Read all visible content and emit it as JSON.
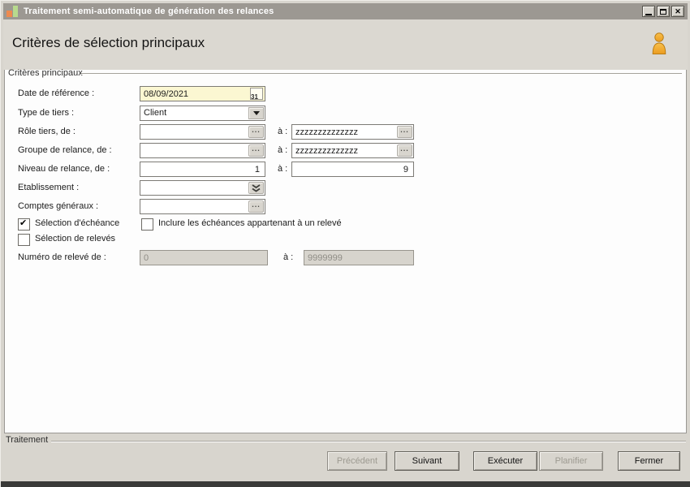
{
  "window": {
    "title": "Traitement semi-automatique de génération des relances"
  },
  "header": {
    "title": "Critères de sélection principaux"
  },
  "main": {
    "group_label": "Critères principaux",
    "fields": {
      "date_reference": {
        "label": "Date de référence :",
        "value": "08/09/2021",
        "calendar_icon_text": "31"
      },
      "type_tiers": {
        "label": "Type de tiers :",
        "value": "Client"
      },
      "role_tiers": {
        "label": "Rôle tiers, de :",
        "from": "",
        "to_label": "à :",
        "to": "zzzzzzzzzzzzzz"
      },
      "groupe_relance": {
        "label": "Groupe de relance, de :",
        "from": "",
        "to_label": "à :",
        "to": "zzzzzzzzzzzzzz"
      },
      "niveau_relance": {
        "label": "Niveau de relance, de :",
        "from": "1",
        "to_label": "à :",
        "to": "9"
      },
      "etablissement": {
        "label": "Etablissement :",
        "value": ""
      },
      "comptes_generaux": {
        "label": "Comptes généraux :",
        "value": ""
      },
      "numero_releve": {
        "label": "Numéro de relevé de :",
        "from": "0",
        "to_label": "à :",
        "to": "9999999",
        "disabled": true
      }
    },
    "checkboxes": {
      "selection_echeance": {
        "label": "Sélection d'échéance",
        "checked": true
      },
      "inclure_echeances": {
        "label": "Inclure les échéances appartenant à un relevé",
        "checked": false
      },
      "selection_releves": {
        "label": "Sélection de relevés",
        "checked": false
      }
    },
    "lookup_button_glyph": "..."
  },
  "footer": {
    "group_label": "Traitement",
    "buttons": [
      {
        "label": "Précédent",
        "disabled": true
      },
      {
        "label": "Suivant",
        "disabled": false
      },
      {
        "label": "Exécuter",
        "disabled": false
      },
      {
        "label": "Planifier",
        "disabled": true
      },
      {
        "label": "Fermer",
        "disabled": false
      }
    ]
  },
  "icons": {
    "app_icon": "orange-green-blocks-logo",
    "user_icon": "orange-person",
    "calendar_icon": "calendar-day-31",
    "lookup_icon": "ellipsis",
    "dropdown_icon": "chevron-down",
    "expand_icon": "double-chevron-down"
  },
  "colors": {
    "titlebar_bg": "#9c9892",
    "chrome_bg": "#d8d5ce",
    "panel_bg": "#fdfdfd",
    "date_field_bg": "#fbf7d2",
    "person_accent": "#f2a93b",
    "calendar_red": "#dd5a28",
    "disabled_text": "#9d9a91",
    "bottom_strip": "#3a3a38"
  }
}
